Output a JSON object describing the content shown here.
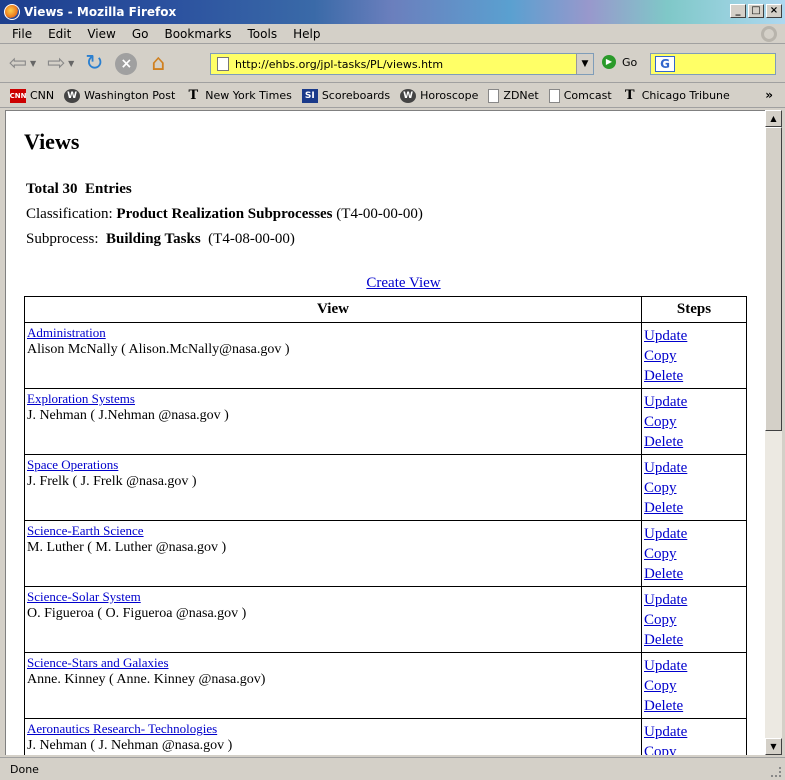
{
  "window": {
    "title": "Views - Mozilla Firefox"
  },
  "menu": [
    "File",
    "Edit",
    "View",
    "Go",
    "Bookmarks",
    "Tools",
    "Help"
  ],
  "nav": {
    "url": "http://ehbs.org/jpl-tasks/PL/views.htm",
    "go_label": "Go",
    "search_value": ""
  },
  "bookmarks": [
    "CNN",
    "Washington Post",
    "New York Times",
    "Scoreboards",
    "Horoscope",
    "ZDNet",
    "Comcast",
    "Chicago Tribune"
  ],
  "bookmark_more": "»",
  "page": {
    "heading": "Views",
    "total_prefix": "Total 30",
    "total_suffix": "Entries",
    "classification_label": "Classification:",
    "classification_name": "Product Realization Subprocesses",
    "classification_code": "(T4-00-00-00)",
    "subprocess_label": "Subprocess:",
    "subprocess_name": "Building Tasks",
    "subprocess_code": "(T4-08-00-00)",
    "create_link": "Create View",
    "col_view": "View",
    "col_steps": "Steps",
    "rows": [
      {
        "name": "Administration",
        "owner": "Alison McNally ( Alison.McNally@nasa.gov )"
      },
      {
        "name": "Exploration Systems",
        "owner": "J. Nehman ( J.Nehman @nasa.gov )"
      },
      {
        "name": "Space Operations",
        "owner": "J. Frelk ( J. Frelk @nasa.gov )"
      },
      {
        "name": "Science-Earth Science",
        "owner": "M. Luther ( M. Luther @nasa.gov )"
      },
      {
        "name": "Science-Solar System",
        "owner": "O. Figueroa ( O. Figueroa @nasa.gov )"
      },
      {
        "name": "Science-Stars and Galaxies",
        "owner": "Anne. Kinney ( Anne. Kinney @nasa.gov)"
      },
      {
        "name": "Aeronautics Research- Technologies",
        "owner": "J. Nehman ( J. Nehman @nasa.gov )"
      }
    ],
    "actions": {
      "update": "Update",
      "copy": "Copy",
      "delete": "Delete"
    }
  },
  "status": "Done",
  "colors": {
    "link": "#0000cc",
    "urlbar": "#ffff66"
  }
}
